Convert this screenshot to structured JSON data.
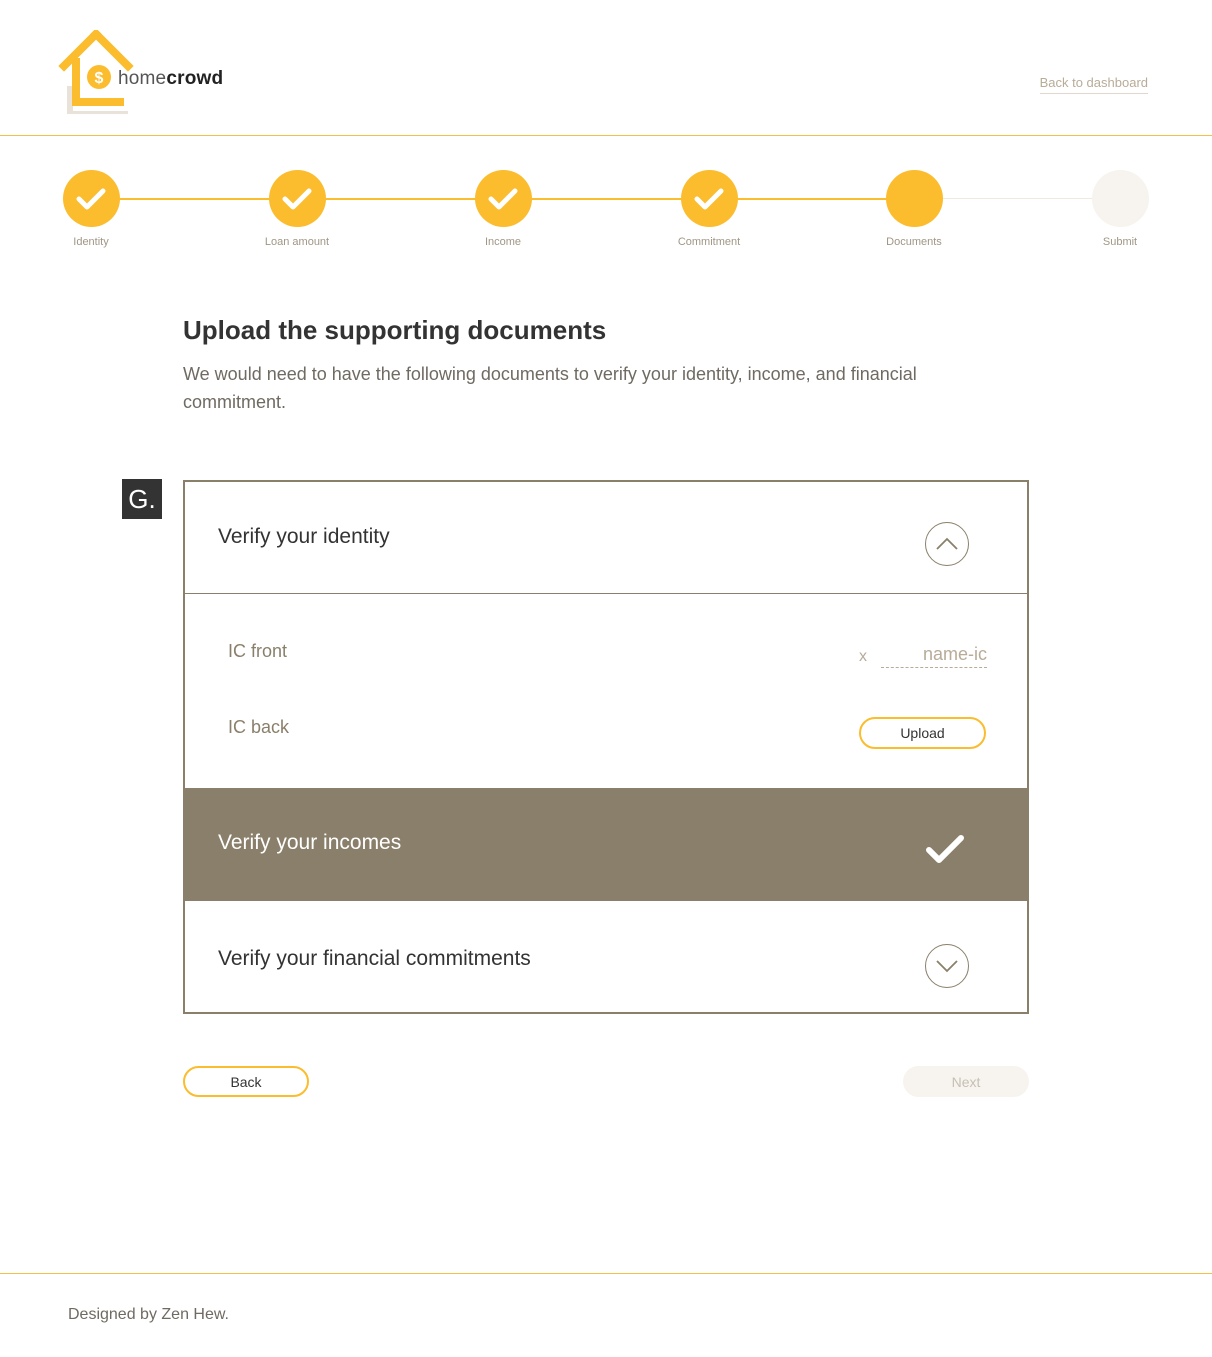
{
  "brand": {
    "name_light": "home",
    "name_bold": "crowd",
    "accent_color": "#fbbc2e",
    "muted_color": "#8a7f6a"
  },
  "header": {
    "back_to_dashboard": "Back to dashboard"
  },
  "stepper": {
    "steps": [
      {
        "label": "Identity",
        "state": "done"
      },
      {
        "label": "Loan amount",
        "state": "done"
      },
      {
        "label": "Income",
        "state": "done"
      },
      {
        "label": "Commitment",
        "state": "done"
      },
      {
        "label": "Documents",
        "state": "current"
      },
      {
        "label": "Submit",
        "state": "pending"
      }
    ]
  },
  "main": {
    "title": "Upload the supporting documents",
    "description": "We would need to have the following documents to verify your identity, income, and financial commitment.",
    "badge": "G."
  },
  "accordion": {
    "identity": {
      "title": "Verify your identity",
      "icon": "chevron-up-icon",
      "documents": {
        "front_label": "IC front",
        "front_remove": "x",
        "front_file": "name-ic",
        "back_label": "IC back",
        "upload_label": "Upload"
      }
    },
    "incomes": {
      "title": "Verify your incomes",
      "icon": "check-icon"
    },
    "commitments": {
      "title": "Verify your financial commitments",
      "icon": "chevron-down-icon"
    }
  },
  "nav": {
    "back_label": "Back",
    "next_label": "Next"
  },
  "footer": {
    "credit": "Designed by Zen Hew."
  }
}
